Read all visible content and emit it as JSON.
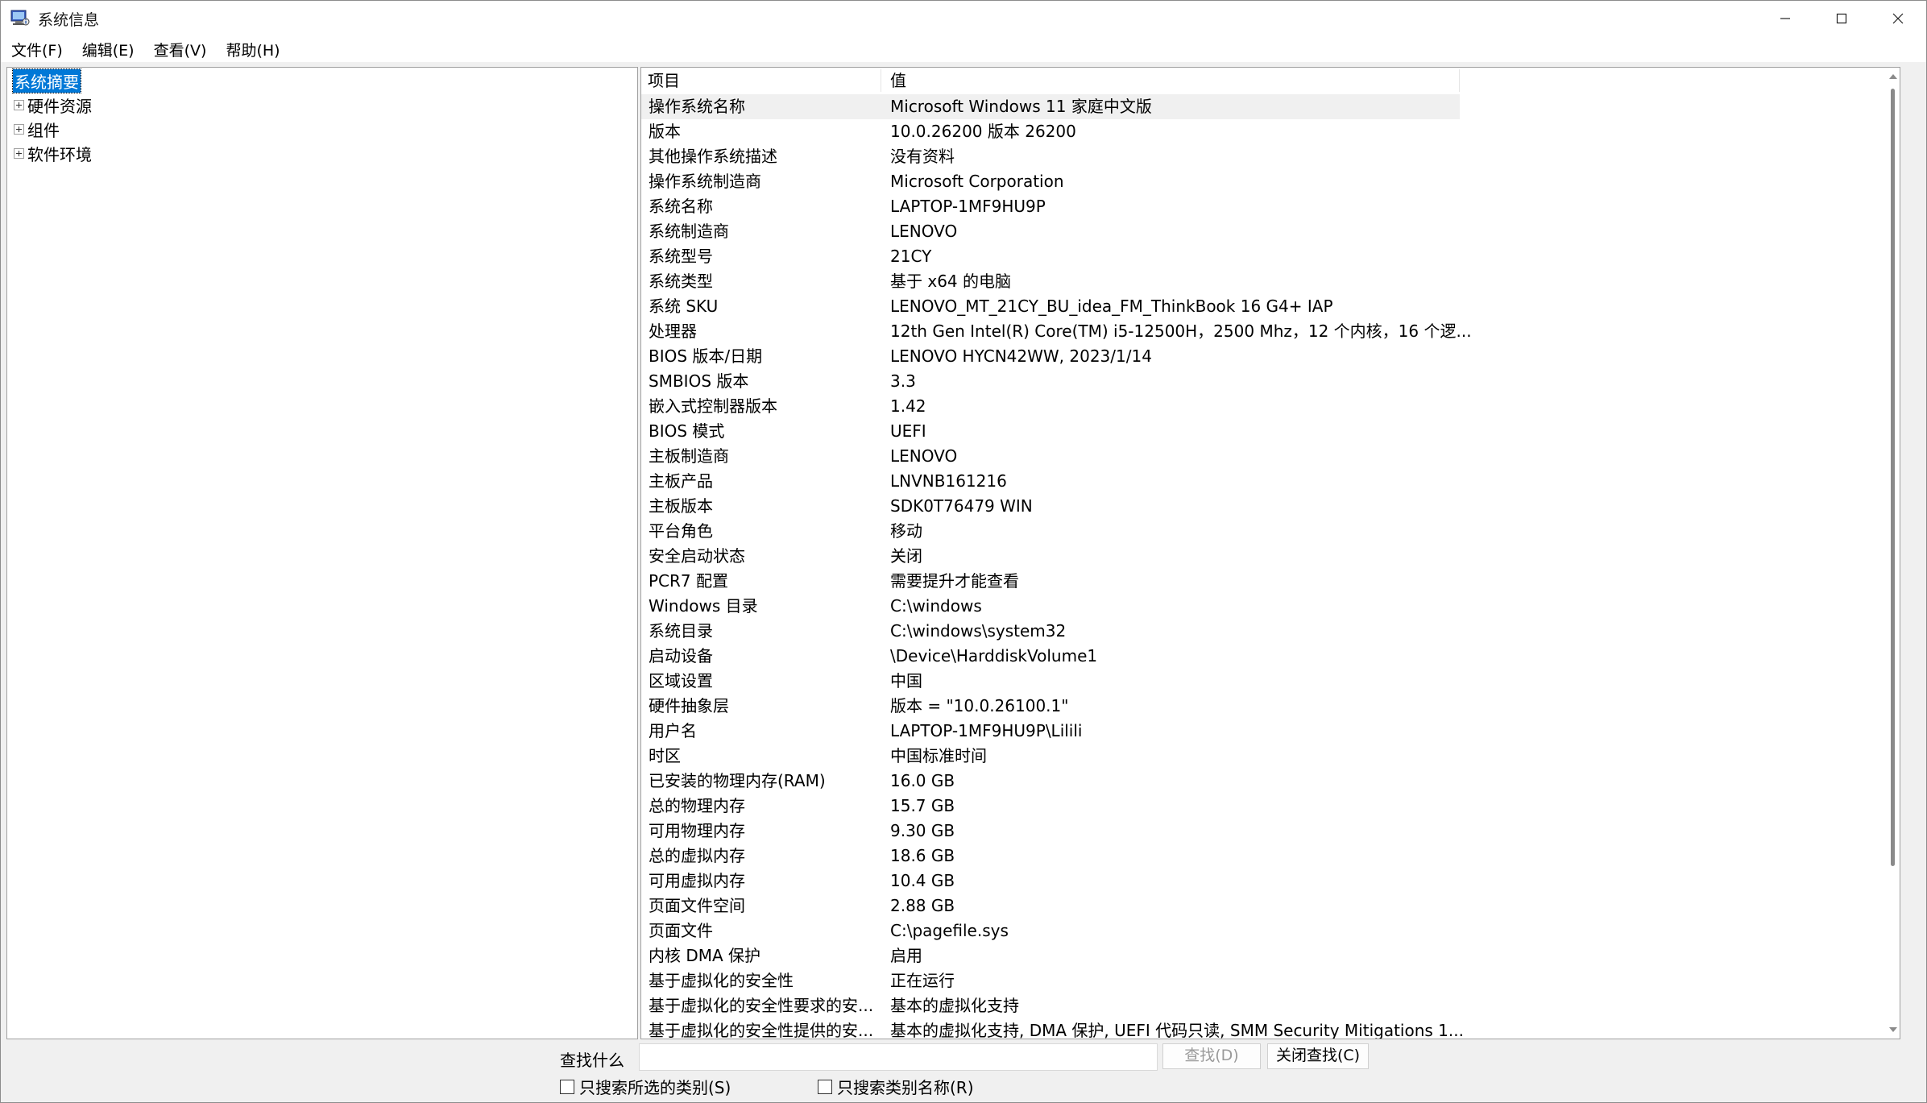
{
  "window": {
    "title": "系统信息"
  },
  "menu": [
    "文件(F)",
    "编辑(E)",
    "查看(V)",
    "帮助(H)"
  ],
  "tree": {
    "items": [
      {
        "label": "系统摘要",
        "selected": true
      },
      {
        "label": "硬件资源",
        "expandable": true
      },
      {
        "label": "组件",
        "expandable": true
      },
      {
        "label": "软件环境",
        "expandable": true
      }
    ]
  },
  "list": {
    "headers": {
      "item": "项目",
      "value": "值"
    },
    "rows": [
      {
        "item": "操作系统名称",
        "value": "Microsoft Windows 11 家庭中文版"
      },
      {
        "item": "版本",
        "value": "10.0.26200 版本 26200"
      },
      {
        "item": "其他操作系统描述",
        "value": "没有资料"
      },
      {
        "item": "操作系统制造商",
        "value": "Microsoft Corporation"
      },
      {
        "item": "系统名称",
        "value": "LAPTOP-1MF9HU9P"
      },
      {
        "item": "系统制造商",
        "value": "LENOVO"
      },
      {
        "item": "系统型号",
        "value": "21CY"
      },
      {
        "item": "系统类型",
        "value": "基于 x64 的电脑"
      },
      {
        "item": "系统 SKU",
        "value": "LENOVO_MT_21CY_BU_idea_FM_ThinkBook 16 G4+ IAP"
      },
      {
        "item": "处理器",
        "value": "12th Gen Intel(R) Core(TM) i5-12500H，2500 Mhz，12 个内核，16 个逻..."
      },
      {
        "item": "BIOS 版本/日期",
        "value": "LENOVO HYCN42WW, 2023/1/14"
      },
      {
        "item": "SMBIOS 版本",
        "value": "3.3"
      },
      {
        "item": "嵌入式控制器版本",
        "value": "1.42"
      },
      {
        "item": "BIOS 模式",
        "value": "UEFI"
      },
      {
        "item": "主板制造商",
        "value": "LENOVO"
      },
      {
        "item": "主板产品",
        "value": "LNVNB161216"
      },
      {
        "item": "主板版本",
        "value": "SDK0T76479 WIN"
      },
      {
        "item": "平台角色",
        "value": "移动"
      },
      {
        "item": "安全启动状态",
        "value": "关闭"
      },
      {
        "item": "PCR7 配置",
        "value": "需要提升才能查看"
      },
      {
        "item": "Windows 目录",
        "value": "C:\\windows"
      },
      {
        "item": "系统目录",
        "value": "C:\\windows\\system32"
      },
      {
        "item": "启动设备",
        "value": "\\Device\\HarddiskVolume1"
      },
      {
        "item": "区域设置",
        "value": "中国"
      },
      {
        "item": "硬件抽象层",
        "value": "版本 = \"10.0.26100.1\""
      },
      {
        "item": "用户名",
        "value": "LAPTOP-1MF9HU9P\\Lilili"
      },
      {
        "item": "时区",
        "value": "中国标准时间"
      },
      {
        "item": "已安装的物理内存(RAM)",
        "value": "16.0 GB"
      },
      {
        "item": "总的物理内存",
        "value": "15.7 GB"
      },
      {
        "item": "可用物理内存",
        "value": "9.30 GB"
      },
      {
        "item": "总的虚拟内存",
        "value": "18.6 GB"
      },
      {
        "item": "可用虚拟内存",
        "value": "10.4 GB"
      },
      {
        "item": "页面文件空间",
        "value": "2.88 GB"
      },
      {
        "item": "页面文件",
        "value": "C:\\pagefile.sys"
      },
      {
        "item": "内核 DMA 保护",
        "value": "启用"
      },
      {
        "item": "基于虚拟化的安全性",
        "value": "正在运行"
      },
      {
        "item": "基于虚拟化的安全性要求的安...",
        "value": "基本的虚拟化支持"
      },
      {
        "item": "基于虚拟化的安全性提供的安...",
        "value": "基本的虚拟化支持, DMA 保护, UEFI 代码只读, SMM Security Mitigations 1..."
      }
    ]
  },
  "search": {
    "label": "查找什么",
    "value": "",
    "find_button": "查找(D)",
    "close_button": "关闭查找(C)",
    "check_selected": "只搜索所选的类别(S)",
    "check_names": "只搜索类别名称(R)"
  },
  "colors": {
    "selection": "#0078d7",
    "border": "#a0a0a0",
    "window_bg": "#f0f0f0"
  }
}
